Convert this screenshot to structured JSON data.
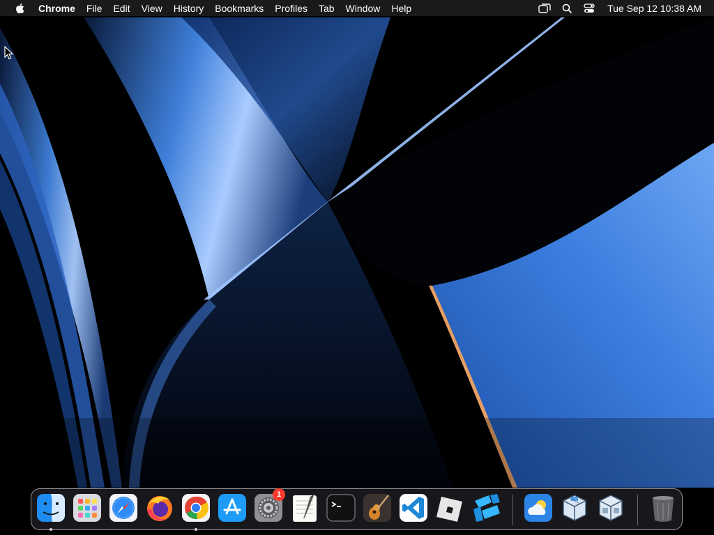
{
  "menubar": {
    "app_name": "Chrome",
    "items": [
      "File",
      "Edit",
      "View",
      "History",
      "Bookmarks",
      "Profiles",
      "Tab",
      "Window",
      "Help"
    ],
    "status_icons": [
      "screen-mirroring-icon",
      "spotlight-search-icon",
      "control-center-icon"
    ],
    "clock": "Tue Sep 12  10:38 AM"
  },
  "dock": {
    "apps": [
      {
        "name": "Finder",
        "icon": "finder-icon",
        "running": true
      },
      {
        "name": "Launchpad",
        "icon": "launchpad-icon",
        "running": false
      },
      {
        "name": "Safari",
        "icon": "safari-icon",
        "running": false
      },
      {
        "name": "Firefox",
        "icon": "firefox-icon",
        "running": false
      },
      {
        "name": "Google Chrome",
        "icon": "chrome-icon",
        "running": true
      },
      {
        "name": "App Store",
        "icon": "app-store-icon",
        "running": false
      },
      {
        "name": "System Settings",
        "icon": "system-settings-icon",
        "running": false,
        "badge": "1"
      },
      {
        "name": "TextEdit",
        "icon": "textedit-icon",
        "running": false
      },
      {
        "name": "Terminal",
        "icon": "terminal-icon",
        "running": false
      },
      {
        "name": "GarageBand",
        "icon": "garageband-icon",
        "running": false
      },
      {
        "name": "Visual Studio Code",
        "icon": "vscode-icon",
        "running": false
      },
      {
        "name": "Roblox",
        "icon": "roblox-icon",
        "running": false
      },
      {
        "name": "Roblox Studio",
        "icon": "roblox-studio-icon",
        "running": false
      },
      {
        "name": "Weather",
        "icon": "weather-icon",
        "running": false
      },
      {
        "name": "VirtualBox",
        "icon": "virtualbox-icon",
        "running": false
      },
      {
        "name": "VirtualBox VM",
        "icon": "virtualbox-vm-icon",
        "running": false
      },
      {
        "name": "Trash",
        "icon": "trash-icon",
        "running": false
      }
    ]
  },
  "colors": {
    "wallpaper_blue": "#3a78d6",
    "wallpaper_highlight": "#9fc3ff",
    "menubar_bg": "#1c1c20",
    "badge_red": "#ff3b30"
  }
}
